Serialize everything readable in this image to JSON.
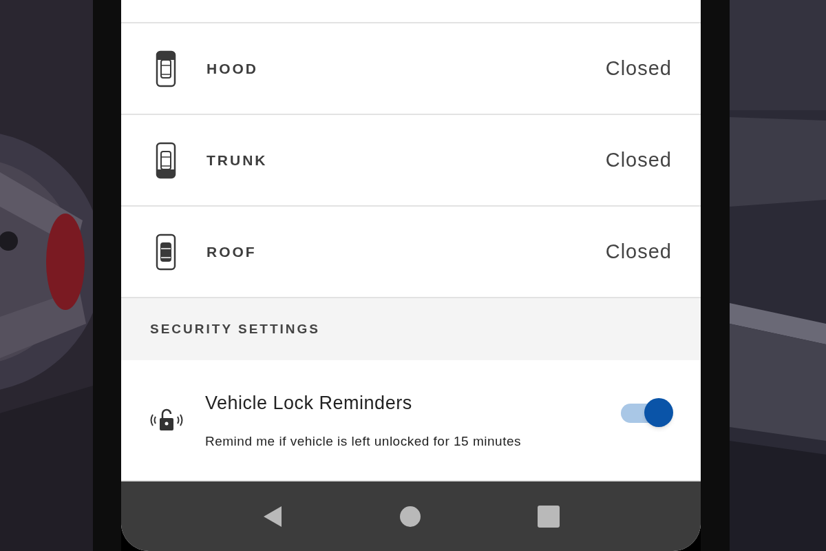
{
  "closures": [
    {
      "kind": "hood",
      "label": "HOOD",
      "status": "Closed"
    },
    {
      "kind": "trunk",
      "label": "TRUNK",
      "status": "Closed"
    },
    {
      "kind": "roof",
      "label": "ROOF",
      "status": "Closed"
    }
  ],
  "section_header": "SECURITY SETTINGS",
  "setting": {
    "title": "Vehicle Lock Reminders",
    "description": "Remind me if vehicle is left unlocked for 15 minutes",
    "on": true
  }
}
